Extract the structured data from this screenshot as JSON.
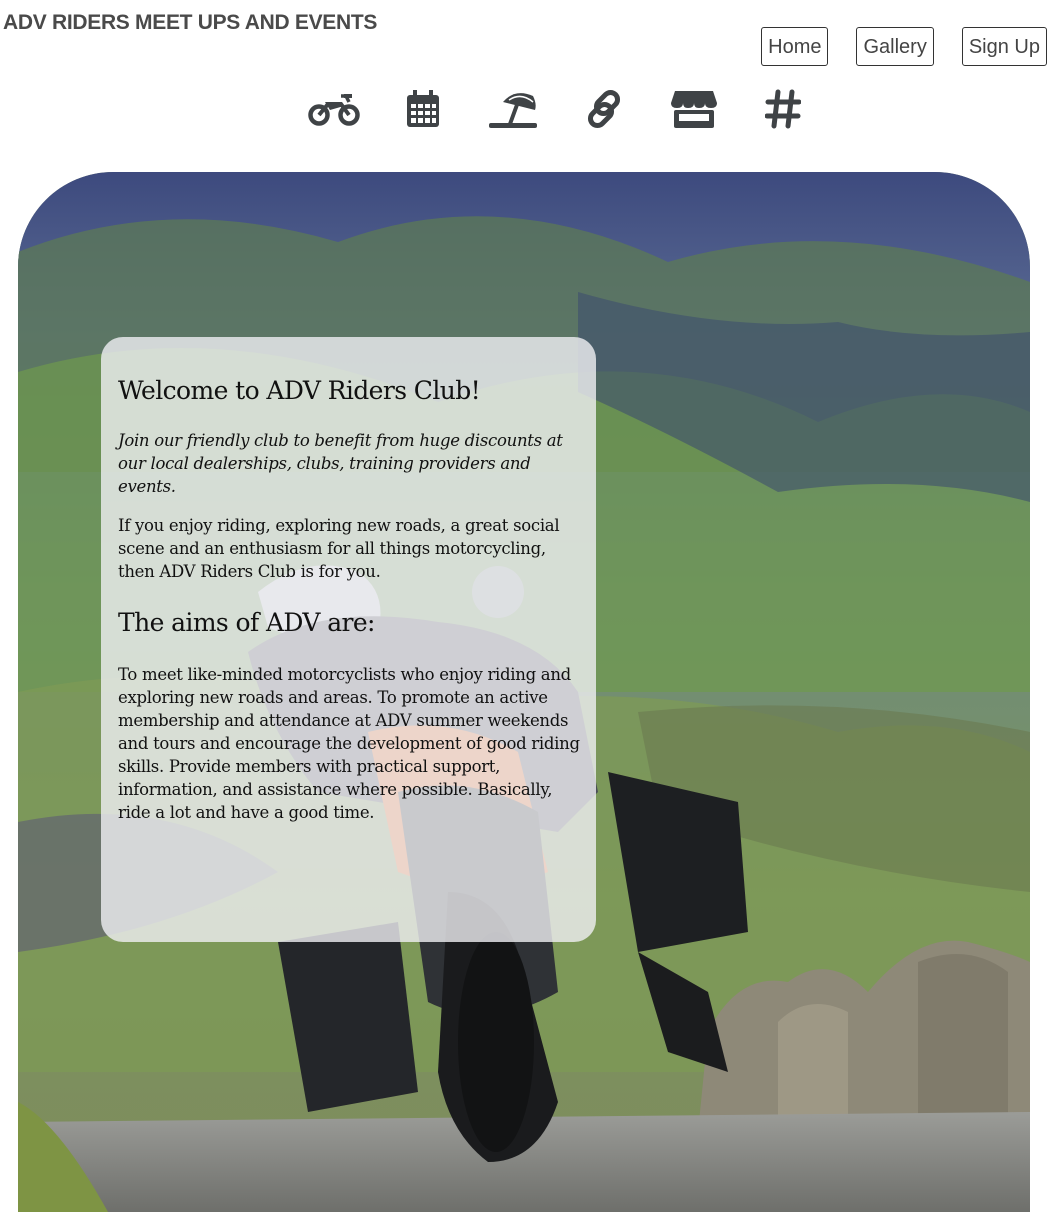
{
  "header": {
    "site_title": "ADV RIDERS MEET UPS AND EVENTS"
  },
  "nav": {
    "home_label": "Home",
    "gallery_label": "Gallery",
    "signup_label": "Sign Up"
  },
  "icons": {
    "items": [
      "motorcycle-icon",
      "calendar-icon",
      "beach-umbrella-icon",
      "link-icon",
      "store-icon",
      "hashtag-icon"
    ],
    "color": "#3f4346"
  },
  "welcome_card": {
    "heading": "Welcome to ADV Riders Club!",
    "intro": "Join our friendly club to benefit from huge discounts at our local dealerships, clubs, training providers and events.",
    "body": "If you enjoy riding, exploring new roads, a great social scene and an enthusiasm for all things motorcycling, then ADV Riders Club is for you.",
    "aims_heading": "The aims of ADV are:",
    "aims_text": "To meet like-minded motorcyclists who enjoy riding and exploring new roads and areas. To promote an active membership and attendance at ADV summer weekends and tours and encourage the development of good riding skills. Provide members with practical support, information, and assistance where possible. Basically, ride a lot and have a good time."
  },
  "colors": {
    "title_text": "#4a4a4a",
    "card_background": "#f0f0f4",
    "hero_sky": "#5d6a9a",
    "hero_hills": "#7d9a5e",
    "road": "#8a8a88"
  }
}
